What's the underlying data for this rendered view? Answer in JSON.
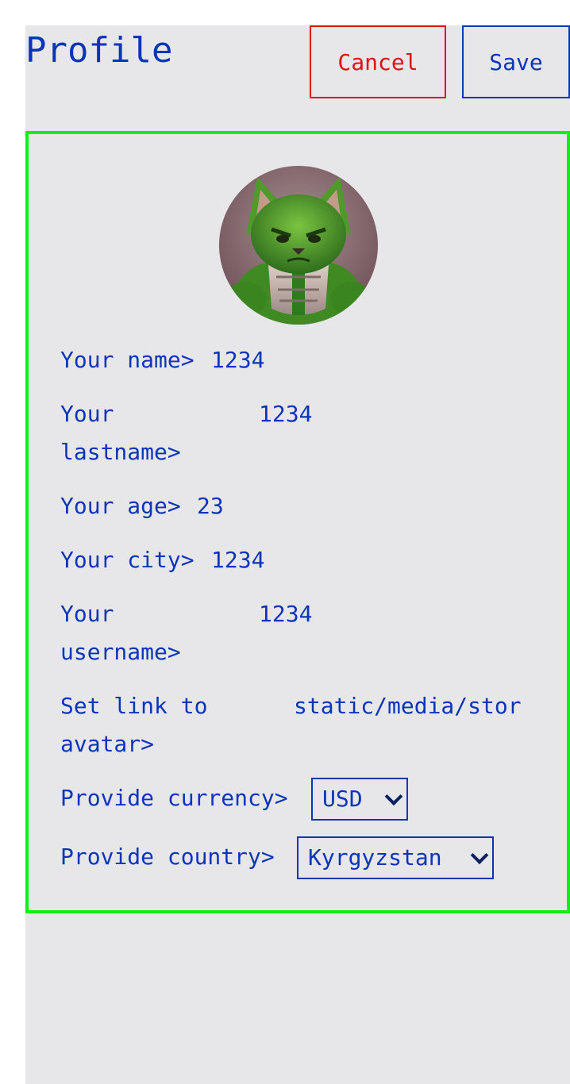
{
  "header": {
    "title": "Profile",
    "cancel_label": "Cancel",
    "save_label": "Save"
  },
  "form": {
    "name": {
      "label": "Your name>",
      "value": "1234"
    },
    "lastname": {
      "label": "Your\nlastname>",
      "value": "1234"
    },
    "age": {
      "label": "Your age>",
      "value": "23"
    },
    "city": {
      "label": "Your city>",
      "value": "1234"
    },
    "username": {
      "label": "Your\nusername>",
      "value": "1234"
    },
    "avatar_link": {
      "label": "Set link to\navatar>",
      "value": "static/media/stor"
    },
    "currency": {
      "label": "Provide currency>",
      "selected": "USD"
    },
    "country": {
      "label": "Provide country>",
      "selected": "Kyrgyzstan"
    }
  },
  "colors": {
    "text": "#0a35b8",
    "cancel": "#e01010",
    "card_border": "#10f010",
    "panel_bg": "#e7e7ea"
  }
}
